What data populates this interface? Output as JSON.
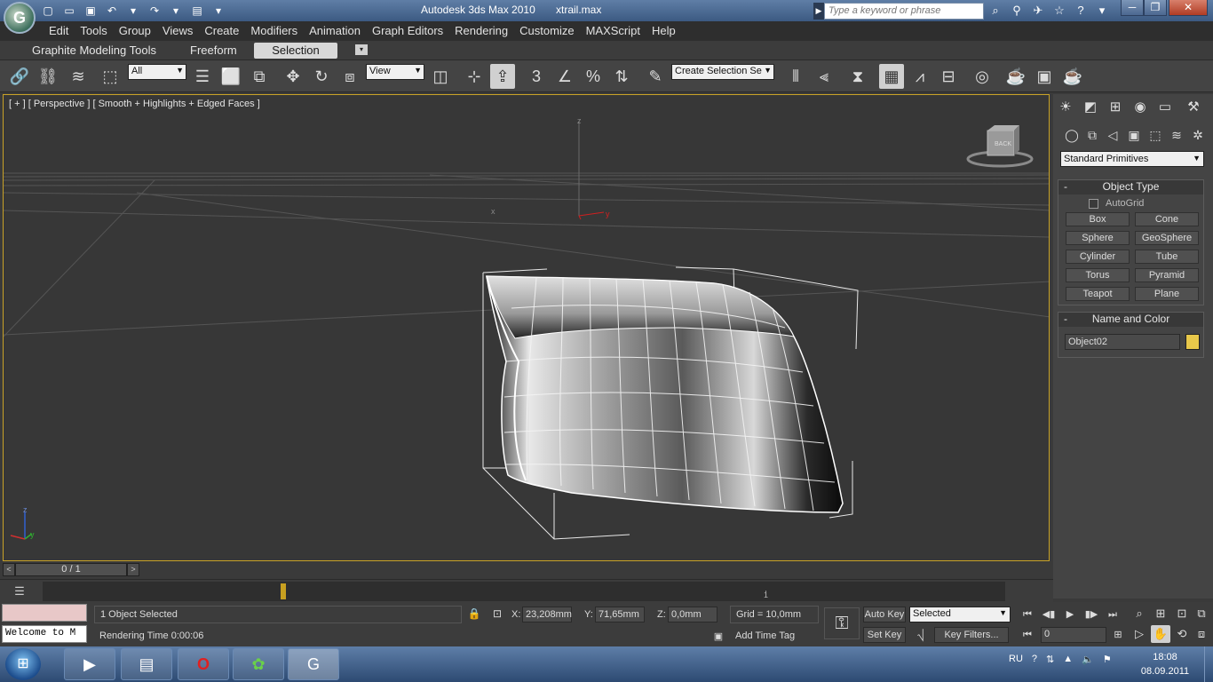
{
  "titlebar": {
    "app_title": "Autodesk 3ds Max  2010",
    "file_name": "xtrail.max",
    "search_placeholder": "Type a keyword or phrase",
    "min_label": "─",
    "max_label": "❐",
    "close_label": "✕"
  },
  "menubar": {
    "items": [
      "Edit",
      "Tools",
      "Group",
      "Views",
      "Create",
      "Modifiers",
      "Animation",
      "Graph Editors",
      "Rendering",
      "Customize",
      "MAXScript",
      "Help"
    ]
  },
  "ribbon": {
    "tabs": [
      "Graphite Modeling Tools",
      "Freeform",
      "Selection"
    ],
    "active_tab": "Selection"
  },
  "toolbar": {
    "selection_filter": "All",
    "reference_coord": "View",
    "named_selection_set": "Create Selection Se",
    "snap_label": "3",
    "percent_label": "%"
  },
  "viewport": {
    "label": "[ + ] [ Perspective ] [ Smooth + Highlights + Edged Faces ]",
    "viewcube_label": "BACK",
    "axis_z": "z",
    "axis_y": "y",
    "axis_x": "x"
  },
  "command_panel": {
    "category_dropdown": "Standard Primitives",
    "object_type_title": "Object Type",
    "autogrid_label": "AutoGrid",
    "primitives": [
      "Box",
      "Cone",
      "Sphere",
      "GeoSphere",
      "Cylinder",
      "Tube",
      "Torus",
      "Pyramid",
      "Teapot",
      "Plane"
    ],
    "name_color_title": "Name and Color",
    "object_name": "Object02",
    "object_color": "#e8c84a",
    "collapse_glyph": "-"
  },
  "timeline": {
    "frame_counter": "0 / 1",
    "left_arrow": "<",
    "right_arrow": ">",
    "track_tick_label": "1",
    "current_frame": 0,
    "total_frames": 1
  },
  "status": {
    "listener_text": "Welcome to M",
    "selection_info": "1 Object Selected",
    "prompt": "Rendering Time  0:00:06",
    "x_label": "X:",
    "x_value": "23,208mm",
    "y_label": "Y:",
    "y_value": "71,65mm",
    "z_label": "Z:",
    "z_value": "0,0mm",
    "grid": "Grid = 10,0mm",
    "add_time_tag": "Add Time Tag",
    "auto_key": "Auto Key",
    "set_key": "Set Key",
    "key_mode": "Selected",
    "key_filters": "Key Filters...",
    "frame_value": "0"
  },
  "taskbar": {
    "language": "RU",
    "time": "18:08",
    "date": "08.09.2011"
  },
  "colors": {
    "viewport_border": "#c9a227",
    "viewport_bg": "#373737",
    "taskbar": "#3d5e8a"
  }
}
